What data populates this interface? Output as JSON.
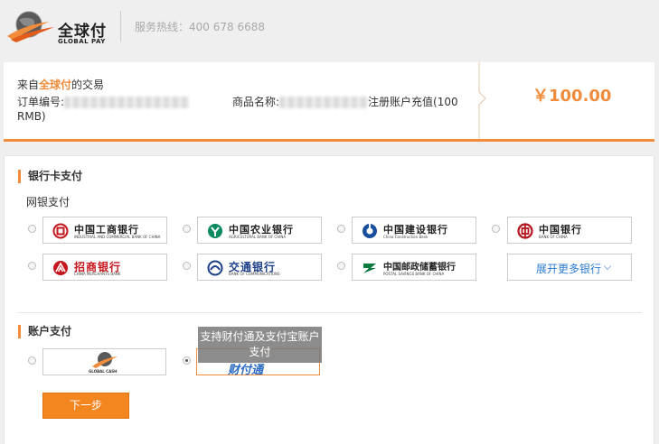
{
  "header": {
    "logo_cn": "全球付",
    "logo_en": "GLOBAL PAY",
    "hotline": "服务热线：400 678 6688"
  },
  "order": {
    "from_prefix": "来自",
    "from_brand": "全球付",
    "from_suffix": "的交易",
    "order_no_label": "订单编号:",
    "product_label": "商品名称:",
    "product_suffix": "注册账户充值(100",
    "product_currency": "RMB)",
    "amount": "￥100.00"
  },
  "bank_section": {
    "title": "银行卡支付",
    "subtitle": "网银支付",
    "banks": [
      {
        "name": "中国工商银行",
        "en": "INDUSTRIAL AND COMMERCIAL BANK OF CHINA",
        "color": "#c4161c"
      },
      {
        "name": "中国农业银行",
        "en": "AGRICULTURAL BANK OF CHINA",
        "color": "#0a8b5f"
      },
      {
        "name": "中国建设银行",
        "en": "China Construction Bank",
        "color": "#1a4fa0"
      },
      {
        "name": "中国银行",
        "en": "BANK OF CHINA",
        "color": "#b5121b"
      },
      {
        "name": "招商银行",
        "en": "CHINA MERCHANTS BANK",
        "color": "#c4161c"
      },
      {
        "name": "交通银行",
        "en": "BANK OF COMMUNICATIONS",
        "color": "#1d3f8a"
      },
      {
        "name": "中国邮政储蓄银行",
        "en": "POSTAL SAVINGS BANK OF CHINA",
        "color": "#0b7a3e"
      }
    ],
    "more_label": "展开更多银行"
  },
  "account_section": {
    "title": "账户支付",
    "options": [
      {
        "name": "GLOBAL CASH"
      },
      {
        "name": "财付通"
      }
    ],
    "tooltip": "支持财付通及支付宝账户支付"
  },
  "actions": {
    "next_label": "下一步"
  },
  "colors": {
    "accent": "#f08c3c",
    "button": "#f4861f",
    "link": "#2b7bd1"
  }
}
